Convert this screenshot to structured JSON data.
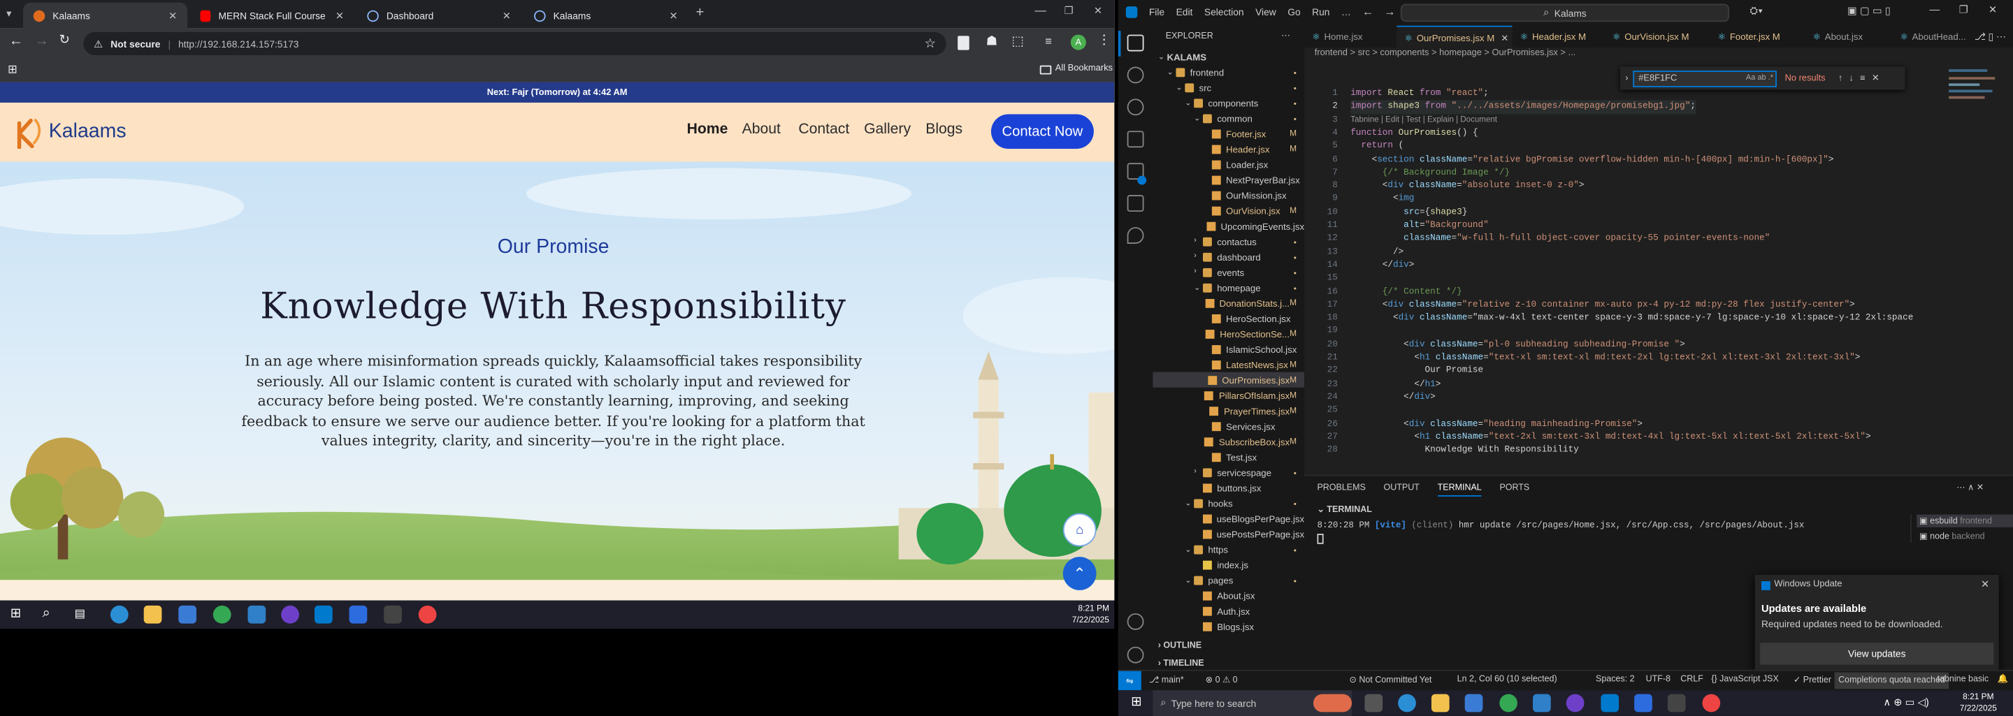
{
  "browser": {
    "tabs": [
      {
        "title": "Kalaams",
        "favicon_color": "#e06b1f"
      },
      {
        "title": "MERN Stack Full Course - ECom",
        "favicon_color": "#ff0000"
      },
      {
        "title": "Dashboard",
        "favicon_color": "#8ab4f8"
      },
      {
        "title": "Kalaams",
        "favicon_color": "#8ab4f8"
      }
    ],
    "security_label": "Not secure",
    "url": "http://192.168.214.157:5173",
    "bookmarks_label": "All Bookmarks",
    "profile_initial": "A"
  },
  "website": {
    "prayer_banner": "Next: Fajr (Tomorrow) at 4:42 AM",
    "logo_text": "Kalaams",
    "nav": [
      "Home",
      "About",
      "Contact",
      "Gallery",
      "Blogs"
    ],
    "contact_button": "Contact Now",
    "eyebrow": "Our Promise",
    "heading": "Knowledge With Responsibility",
    "body_lines": [
      "In an age where misinformation spreads quickly, Kalaamsofficial takes responsibility",
      "seriously. All our Islamic content is curated with scholarly input and reviewed for",
      "accuracy before being posted. We're constantly learning, improving, and seeking",
      "feedback to ensure we serve our audience better. If you're looking for a platform that",
      "values integrity, clarity, and sincerity—you're in the right place."
    ]
  },
  "taskbar_left": {
    "time": "8:21 PM",
    "date": "7/22/2025"
  },
  "vscode": {
    "menu": [
      "File",
      "Edit",
      "Selection",
      "View",
      "Go",
      "Run",
      "…"
    ],
    "search_placeholder": "Kalams",
    "explorer_title": "EXPLORER",
    "tree": [
      {
        "label": "KALAMS",
        "indent": 0,
        "type": "root"
      },
      {
        "label": "frontend",
        "indent": 1,
        "type": "folder-open"
      },
      {
        "label": "src",
        "indent": 2,
        "type": "folder-open"
      },
      {
        "label": "components",
        "indent": 3,
        "type": "folder-open"
      },
      {
        "label": "common",
        "indent": 4,
        "type": "folder-open"
      },
      {
        "label": "Footer.jsx",
        "indent": 5,
        "type": "file",
        "mark": "M"
      },
      {
        "label": "Header.jsx",
        "indent": 5,
        "type": "file",
        "mark": "M"
      },
      {
        "label": "Loader.jsx",
        "indent": 5,
        "type": "file",
        "mark": ""
      },
      {
        "label": "NextPrayerBar.jsx",
        "indent": 5,
        "type": "file",
        "mark": ""
      },
      {
        "label": "OurMission.jsx",
        "indent": 5,
        "type": "file",
        "mark": ""
      },
      {
        "label": "OurVision.jsx",
        "indent": 5,
        "type": "file",
        "mark": "M"
      },
      {
        "label": "UpcomingEvents.jsx",
        "indent": 5,
        "type": "file",
        "mark": ""
      },
      {
        "label": "contactus",
        "indent": 4,
        "type": "folder"
      },
      {
        "label": "dashboard",
        "indent": 4,
        "type": "folder"
      },
      {
        "label": "events",
        "indent": 4,
        "type": "folder"
      },
      {
        "label": "homepage",
        "indent": 4,
        "type": "folder-open"
      },
      {
        "label": "DonationStats.j...",
        "indent": 5,
        "type": "file",
        "mark": "M"
      },
      {
        "label": "HeroSection.jsx",
        "indent": 5,
        "type": "file",
        "mark": ""
      },
      {
        "label": "HeroSectionSe...",
        "indent": 5,
        "type": "file",
        "mark": "M"
      },
      {
        "label": "IslamicSchool.jsx",
        "indent": 5,
        "type": "file",
        "mark": ""
      },
      {
        "label": "LatestNews.jsx",
        "indent": 5,
        "type": "file",
        "mark": "M"
      },
      {
        "label": "OurPromises.jsx",
        "indent": 5,
        "type": "file",
        "mark": "M",
        "selected": true
      },
      {
        "label": "PillarsOfIslam.jsx",
        "indent": 5,
        "type": "file",
        "mark": "M"
      },
      {
        "label": "PrayerTimes.jsx",
        "indent": 5,
        "type": "file",
        "mark": "M"
      },
      {
        "label": "Services.jsx",
        "indent": 5,
        "type": "file",
        "mark": ""
      },
      {
        "label": "SubscribeBox.jsx",
        "indent": 5,
        "type": "file",
        "mark": "M"
      },
      {
        "label": "Test.jsx",
        "indent": 5,
        "type": "file",
        "mark": ""
      },
      {
        "label": "servicespage",
        "indent": 4,
        "type": "folder"
      },
      {
        "label": "buttons.jsx",
        "indent": 4,
        "type": "file",
        "mark": ""
      },
      {
        "label": "hooks",
        "indent": 3,
        "type": "folder-open"
      },
      {
        "label": "useBlogsPerPage.jsx",
        "indent": 4,
        "type": "file",
        "mark": ""
      },
      {
        "label": "usePostsPerPage.jsx",
        "indent": 4,
        "type": "file",
        "mark": ""
      },
      {
        "label": "https",
        "indent": 3,
        "type": "folder-open"
      },
      {
        "label": "index.js",
        "indent": 4,
        "type": "file",
        "mark": ""
      },
      {
        "label": "pages",
        "indent": 3,
        "type": "folder-open"
      },
      {
        "label": "About.jsx",
        "indent": 4,
        "type": "file",
        "mark": ""
      },
      {
        "label": "Auth.jsx",
        "indent": 4,
        "type": "file",
        "mark": ""
      },
      {
        "label": "Blogs.jsx",
        "indent": 4,
        "type": "file",
        "mark": ""
      }
    ],
    "outline_label": "OUTLINE",
    "timeline_label": "TIMELINE",
    "editor_tabs": [
      {
        "label": "Home.jsx",
        "mark": ""
      },
      {
        "label": "OurPromises.jsx",
        "mark": "M",
        "active": true
      },
      {
        "label": "Header.jsx",
        "mark": "M"
      },
      {
        "label": "OurVision.jsx",
        "mark": "M"
      },
      {
        "label": "Footer.jsx",
        "mark": "M"
      },
      {
        "label": "About.jsx",
        "mark": ""
      },
      {
        "label": "AboutHead...",
        "mark": ""
      }
    ],
    "breadcrumb": "frontend > src > components > homepage > OurPromises.jsx > ...",
    "find_value": "#E8F1FC",
    "find_result": "No results",
    "codelens": "Tabnine | Edit | Test | Explain | Document",
    "code_lines": [
      {
        "n": "1",
        "text": "import React from \"react\";"
      },
      {
        "n": "2",
        "text": "import shape3 from \"../../assets/images/Homepage/promisebg1.jpg\";"
      },
      {
        "n": "3",
        "text": ""
      },
      {
        "n": "4",
        "text": "function OurPromises() {"
      },
      {
        "n": "5",
        "text": "  return ("
      },
      {
        "n": "6",
        "text": "    <section className=\"relative bgPromise overflow-hidden min-h-[400px] md:min-h-[600px]\">"
      },
      {
        "n": "7",
        "text": "      {/* Background Image */}"
      },
      {
        "n": "8",
        "text": "      <div className=\"absolute inset-0 z-0\">"
      },
      {
        "n": "9",
        "text": "        <img"
      },
      {
        "n": "10",
        "text": "          src={shape3}"
      },
      {
        "n": "11",
        "text": "          alt=\"Background\""
      },
      {
        "n": "12",
        "text": "          className=\"w-full h-full object-cover opacity-55 pointer-events-none\""
      },
      {
        "n": "13",
        "text": "        />"
      },
      {
        "n": "14",
        "text": "      </div>"
      },
      {
        "n": "15",
        "text": ""
      },
      {
        "n": "16",
        "text": "      {/* Content */}"
      },
      {
        "n": "17",
        "text": "      <div className=\"relative z-10 container mx-auto px-4 py-12 md:py-28 flex justify-center\">"
      },
      {
        "n": "18",
        "text": "        <div className=\"max-w-4xl text-center space-y-3 md:space-y-7 lg:space-y-10 xl:space-y-12 2xl:space"
      },
      {
        "n": "19",
        "text": ""
      },
      {
        "n": "20",
        "text": "          <div className=\"pl-0 subheading subheading-Promise \">"
      },
      {
        "n": "21",
        "text": "            <h1 className=\"text-xl sm:text-xl md:text-2xl lg:text-2xl xl:text-3xl 2xl:text-3xl\">"
      },
      {
        "n": "22",
        "text": "              Our Promise"
      },
      {
        "n": "23",
        "text": "            </h1>"
      },
      {
        "n": "24",
        "text": "          </div>"
      },
      {
        "n": "25",
        "text": ""
      },
      {
        "n": "26",
        "text": "          <div className=\"heading mainheading-Promise\">"
      },
      {
        "n": "27",
        "text": "            <h1 className=\"text-2xl sm:text-3xl md:text-4xl lg:text-5xl xl:text-5xl 2xl:text-5xl\">"
      },
      {
        "n": "28",
        "text": "              Knowledge With Responsibility"
      }
    ],
    "panel_tabs": [
      "PROBLEMS",
      "OUTPUT",
      "TERMINAL",
      "PORTS"
    ],
    "terminal_header": "TERMINAL",
    "terminal_time": "8:20:28 PM",
    "terminal_tag": "[vite]",
    "terminal_client": "(client)",
    "terminal_msg": "hmr update /src/pages/Home.jsx, /src/App.css, /src/pages/About.jsx",
    "terminal_list": [
      {
        "name": "esbuild",
        "sub": "frontend"
      },
      {
        "name": "node",
        "sub": "backend"
      }
    ],
    "toast": {
      "app": "Windows Update",
      "title": "Updates are available",
      "body": "Required updates need to be downloaded.",
      "button": "View updates"
    },
    "status": {
      "branch": "main*",
      "problems": "⊗ 0 ⚠ 0",
      "commit": "Not Committed Yet",
      "position": "Ln 2, Col 60 (10 selected)",
      "spaces": "Spaces: 2",
      "encoding": "UTF-8",
      "eol": "CRLF",
      "language": "JavaScript JSX",
      "prettier": "✓ Prettier",
      "quota": "Completions quota reached",
      "tabnine": "tabnine basic"
    }
  },
  "taskbar_right": {
    "search_placeholder": "Type here to search",
    "time": "8:21 PM",
    "date": "7/22/2025"
  },
  "colors": {
    "brand_blue": "#1a42d6",
    "prayer_bar": "#243a8a",
    "nav_bg": "#fde2c4",
    "vscode_accent": "#0078d4"
  }
}
